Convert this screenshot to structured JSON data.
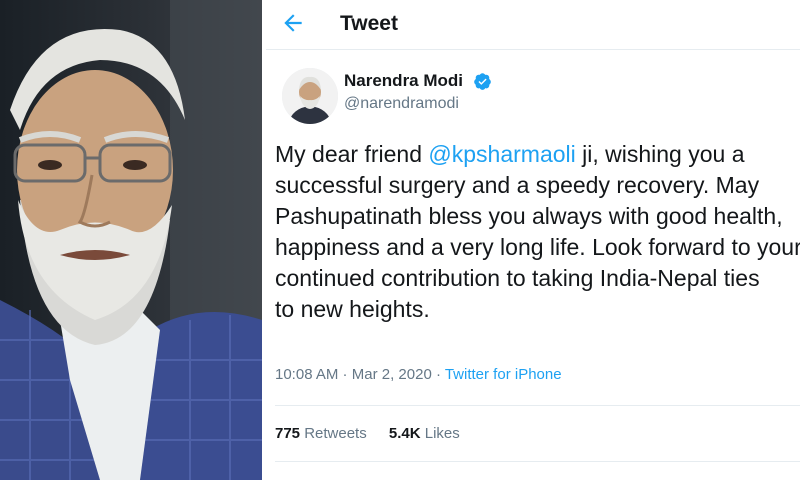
{
  "header": {
    "title": "Tweet",
    "back_icon": "arrow-left-icon"
  },
  "author": {
    "display_name": "Narendra Modi",
    "handle": "@narendramodi",
    "verified_icon": "verified-badge-icon"
  },
  "tweet": {
    "lines": [
      {
        "pre": "My dear friend ",
        "mention": "@kpsharmaoli",
        "post": " ji, wishing you a"
      },
      {
        "text": "successful surgery and a speedy recovery. May"
      },
      {
        "text": "Pashupatinath bless you always with good health,"
      },
      {
        "text": "happiness and a very long life. Look forward to your"
      },
      {
        "text": "continued contribution to taking India-Nepal ties"
      },
      {
        "text": "to new heights."
      }
    ]
  },
  "meta": {
    "time": "10:08 AM",
    "dot1": " · ",
    "date": "Mar 2, 2020",
    "dot2": " · ",
    "source": "Twitter for iPhone"
  },
  "stats": {
    "retweets_count": "775",
    "retweets_label": " Retweets",
    "likes_count": "5.4K",
    "likes_label": " Likes"
  },
  "colors": {
    "accent": "#1da1f2",
    "text": "#14171a",
    "muted": "#657786",
    "border": "#e6ecf0"
  }
}
